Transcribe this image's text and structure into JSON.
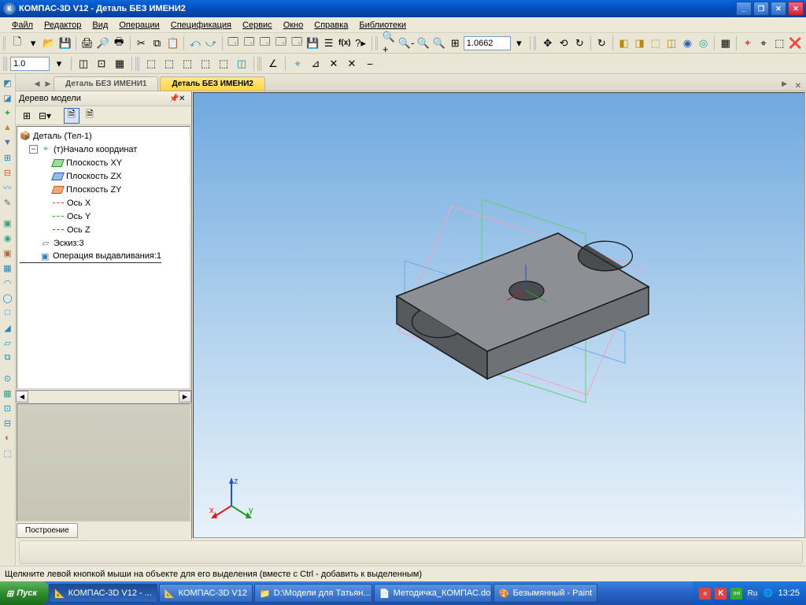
{
  "title": "КОМПАС-3D V12  -  Деталь БЕЗ ИМЕНИ2",
  "menu": [
    "Файл",
    "Редактор",
    "Вид",
    "Операции",
    "Спецификация",
    "Сервис",
    "Окно",
    "Справка",
    "Библиотеки"
  ],
  "zoom": "1.0662",
  "line_weight": "1.0",
  "tabs": [
    {
      "label": "Деталь БЕЗ ИМЕНИ1",
      "active": false
    },
    {
      "label": "Деталь БЕЗ ИМЕНИ2",
      "active": true
    }
  ],
  "tree_panel": {
    "title": "Дерево модели",
    "bottom_tab": "Построение",
    "root": "Деталь (Тел-1)",
    "origin": "(т)Начало координат",
    "planes": {
      "xy": "Плоскость XY",
      "zx": "Плоскость ZX",
      "zy": "Плоскость ZY"
    },
    "axes": {
      "x": "Ось X",
      "y": "Ось Y",
      "z": "Ось Z"
    },
    "sketch": "Эскиз:3",
    "feature": "Операция выдавливания:1"
  },
  "gizmo": {
    "x": "x",
    "y": "y",
    "z": "z"
  },
  "status": "Щелкните левой кнопкой мыши на объекте для его выделения (вместе с Ctrl - добавить к выделенным)",
  "taskbar": {
    "start": "Пуск",
    "items": [
      "КОМПАС-3D V12 - ...",
      "КОМПАС-3D V12",
      "D:\\Модели для Татьян...",
      "Методичка_КОМПАС.do...",
      "Безымянный - Paint"
    ],
    "clock": "13:25",
    "lang": "Ru"
  }
}
